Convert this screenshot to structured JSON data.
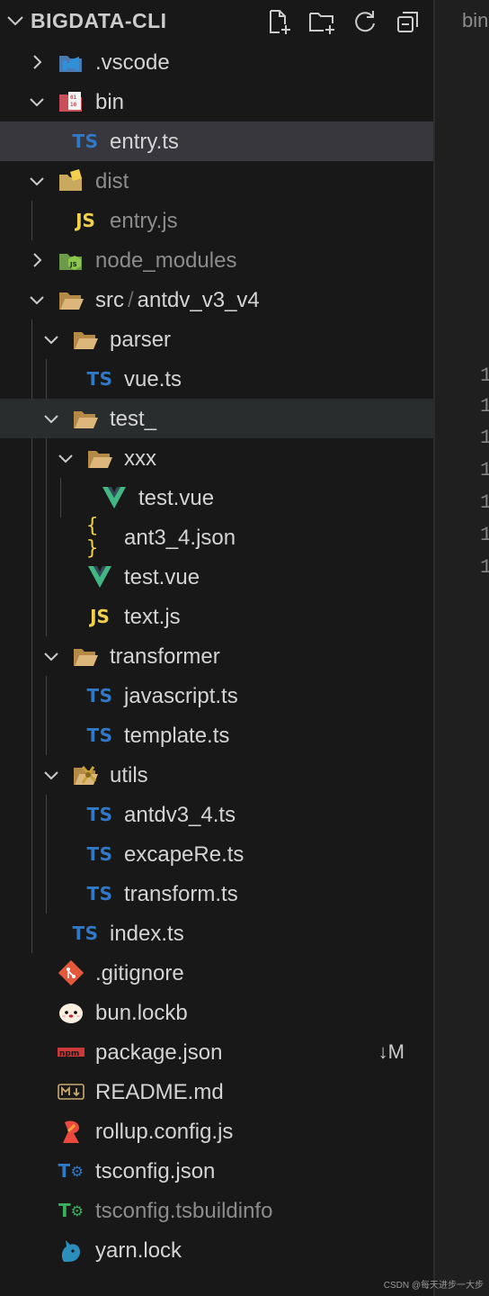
{
  "explorer": {
    "title": "BIGDATA-CLI",
    "actions": [
      "new-file",
      "new-folder",
      "refresh",
      "collapse-all"
    ]
  },
  "tree": [
    {
      "label": ".vscode",
      "type": "folder",
      "icon": "vscode-folder-icon"
    },
    {
      "label": "bin",
      "type": "folder",
      "icon": "binary-folder-icon"
    },
    {
      "label": "entry.ts",
      "type": "file",
      "icon": "typescript-icon"
    },
    {
      "label": "dist",
      "type": "folder",
      "icon": "dist-folder-icon"
    },
    {
      "label": "entry.js",
      "type": "file",
      "icon": "javascript-icon"
    },
    {
      "label": "node_modules",
      "type": "folder",
      "icon": "node-folder-icon"
    },
    {
      "label": "src",
      "label2": "antdv_v3_v4",
      "type": "folder",
      "icon": "folder-open-icon"
    },
    {
      "label": "parser",
      "type": "folder",
      "icon": "folder-open-icon"
    },
    {
      "label": "vue.ts",
      "type": "file",
      "icon": "typescript-icon"
    },
    {
      "label": "test_",
      "type": "folder",
      "icon": "folder-open-icon"
    },
    {
      "label": "xxx",
      "type": "folder",
      "icon": "folder-open-icon"
    },
    {
      "label": "test.vue",
      "type": "file",
      "icon": "vue-icon"
    },
    {
      "label": "ant3_4.json",
      "type": "file",
      "icon": "json-icon"
    },
    {
      "label": "test.vue",
      "type": "file",
      "icon": "vue-icon"
    },
    {
      "label": "text.js",
      "type": "file",
      "icon": "javascript-icon"
    },
    {
      "label": "transformer",
      "type": "folder",
      "icon": "folder-open-icon"
    },
    {
      "label": "javascript.ts",
      "type": "file",
      "icon": "typescript-icon"
    },
    {
      "label": "template.ts",
      "type": "file",
      "icon": "typescript-icon"
    },
    {
      "label": "utils",
      "type": "folder",
      "icon": "utils-folder-icon"
    },
    {
      "label": "antdv3_4.ts",
      "type": "file",
      "icon": "typescript-icon"
    },
    {
      "label": "excapeRe.ts",
      "type": "file",
      "icon": "typescript-icon"
    },
    {
      "label": "transform.ts",
      "type": "file",
      "icon": "typescript-icon"
    },
    {
      "label": "index.ts",
      "type": "file",
      "icon": "typescript-icon"
    },
    {
      "label": ".gitignore",
      "type": "file",
      "icon": "git-icon"
    },
    {
      "label": "bun.lockb",
      "type": "file",
      "icon": "bun-icon"
    },
    {
      "label": "package.json",
      "type": "file",
      "icon": "npm-icon",
      "badge": "↓M"
    },
    {
      "label": "README.md",
      "type": "file",
      "icon": "markdown-icon"
    },
    {
      "label": "rollup.config.js",
      "type": "file",
      "icon": "rollup-icon"
    },
    {
      "label": "tsconfig.json",
      "type": "file",
      "icon": "tsconfig-icon"
    },
    {
      "label": "tsconfig.tsbuildinfo",
      "type": "file",
      "icon": "tsbuildinfo-icon"
    },
    {
      "label": "yarn.lock",
      "type": "file",
      "icon": "yarn-icon"
    }
  ],
  "editor": {
    "tab_label": "bin",
    "line_numbers": [
      "1",
      "1",
      "1",
      "1",
      "1",
      "1",
      "1"
    ]
  },
  "watermark": "CSDN @每天进步一大步",
  "colors": {
    "sidebar": "#181818",
    "selected_row": "#37373d",
    "typescript": "#3178c6",
    "javascript": "#f1d14c",
    "vue": "#41b883",
    "folder": "#dcb67a"
  }
}
